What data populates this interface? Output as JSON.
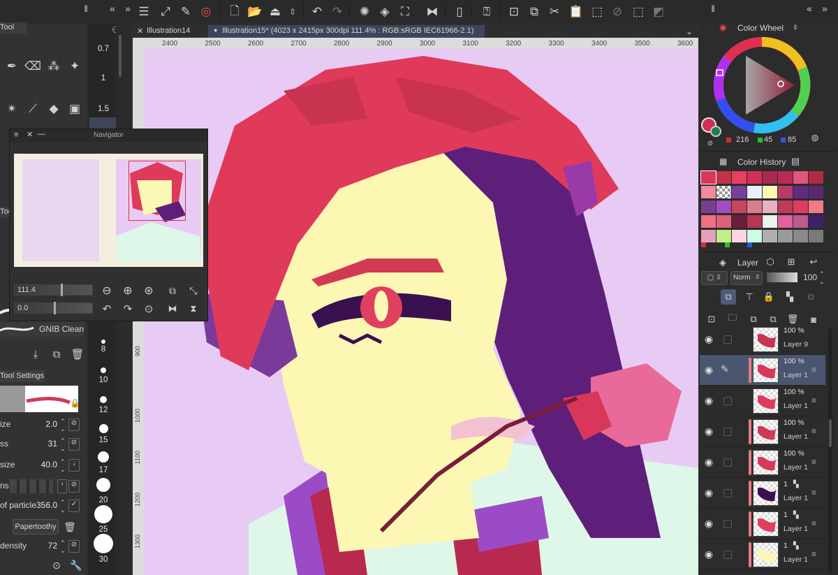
{
  "document": {
    "tabs": [
      {
        "label": "Illustration14"
      },
      {
        "label": "Illustration15* (4023 x 2415px 300dpi 111.4% : RGB:sRGB IEC61966-2.1)"
      }
    ]
  },
  "ruler": {
    "top": [
      "2400",
      "2500",
      "2600",
      "2700",
      "2800",
      "2900",
      "3000",
      "3100",
      "3200",
      "3300",
      "3400",
      "3500",
      "3600"
    ],
    "left": [
      "900",
      "1000",
      "1100",
      "1200",
      "1300"
    ]
  },
  "left_panel": {
    "tool_tab": "Tool",
    "sub_tool_tab": "Tool",
    "brush_items": [
      {
        "label": "GNIB Clean"
      }
    ],
    "tool_settings_title": "Tool Settings",
    "settings": [
      {
        "label": "ize",
        "value": "2.0"
      },
      {
        "label": "ss",
        "value": "31"
      },
      {
        "label": "size",
        "value": "40.0"
      },
      {
        "label": "ns",
        "value": ""
      },
      {
        "label": "of particle",
        "value": "356.0"
      },
      {
        "label": "density",
        "value": "72"
      }
    ],
    "texture_label": "Papertoothy"
  },
  "brush_sizes": [
    "0.7",
    "1",
    "1.5",
    "8",
    "10",
    "12",
    "15",
    "17",
    "20",
    "25",
    "30"
  ],
  "navigator": {
    "title": "Navigator",
    "zoom": "111.4",
    "rotation": "0.0"
  },
  "color_wheel": {
    "title": "Color Wheel",
    "r": "216",
    "g": "45",
    "b": "85",
    "main_color": "#d82d55",
    "sub_color": "#1e7f4a"
  },
  "color_history": {
    "title": "Color History",
    "swatches": [
      "#d8375a",
      "#c0334a",
      "#e8405e",
      "#d12f5b",
      "#a72a4f",
      "#b92b55",
      "#e0557a",
      "#ad2a43",
      "#f08a98",
      "checker",
      "#7a3f9a",
      "#e8f0ff",
      "#fdf7b4",
      "#b83a66",
      "#602c7d",
      "#5a2a70",
      "#7b3d8f",
      "#a04ec1",
      "#c8455e",
      "#d87d8c",
      "#e8b3c1",
      "#c03a5a",
      "#e03c62",
      "#f07b8a",
      "#f07080",
      "#e0607a",
      "#6a1f3c",
      "#b83654",
      "#f0f0f0",
      "#e060a0",
      "#c05a8a",
      "#40206a",
      "#e6a0c0",
      "#c0ef88",
      "#ffd3e0",
      "#c8ffe4",
      "#b0b0b0",
      "#9a9a9a",
      "#8a8a8a",
      "#7a7a7a"
    ]
  },
  "layers": {
    "title": "Layer",
    "blend_mode": "Norm",
    "opacity": "100",
    "items": [
      {
        "opacity": "100 %",
        "name": "Layer 9"
      },
      {
        "opacity": "100 %",
        "name": "Layer 1"
      },
      {
        "opacity": "100 %",
        "name": "Layer 1"
      },
      {
        "opacity": "100 %",
        "name": "Layer 1"
      },
      {
        "opacity": "100 %",
        "name": "Layer 1"
      },
      {
        "opacity": "1",
        "name": "Layer 1"
      },
      {
        "opacity": "1",
        "name": "Layer 1"
      },
      {
        "opacity": "1",
        "name": "Layer 1"
      }
    ]
  }
}
